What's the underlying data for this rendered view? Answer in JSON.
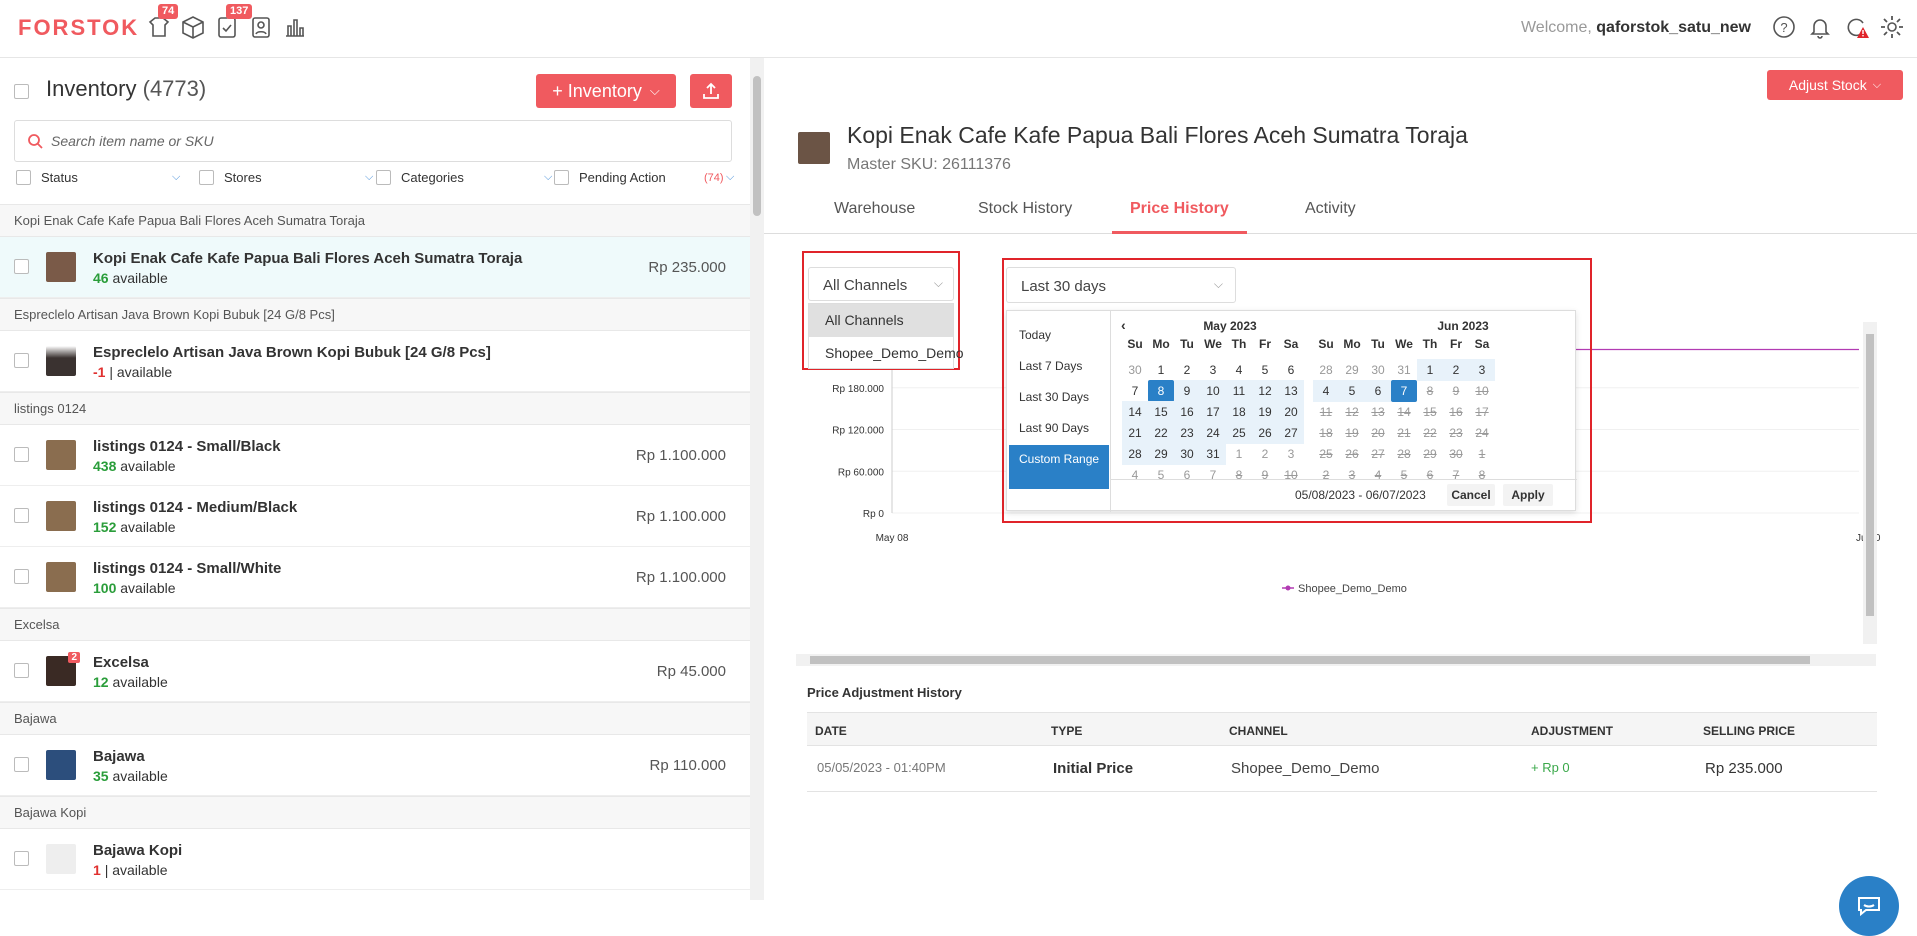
{
  "app": {
    "logo": "FORSTOK"
  },
  "nav": {
    "badges": {
      "products": "74",
      "orders": "137"
    },
    "welcome_prefix": "Welcome,",
    "username": "qaforstok_satu_new"
  },
  "inventory": {
    "title": "Inventory",
    "count": "(4773)",
    "add_button": "+ Inventory",
    "search_placeholder": "Search item name or SKU",
    "filters": {
      "status": "Status",
      "stores": "Stores",
      "categories": "Categories",
      "pending": "Pending Action",
      "pending_count": "(74)"
    },
    "groups": [
      {
        "label": "Kopi Enak Cafe Kafe Papua Bali Flores Aceh Sumatra Toraja",
        "items": [
          {
            "name": "Kopi Enak Cafe Kafe Papua Bali Flores Aceh Sumatra Toraja",
            "qty": "46",
            "suffix": "available",
            "price": "Rp 235.000"
          }
        ]
      },
      {
        "label": "Espreclelo Artisan Java Brown Kopi Bubuk [24 G/8 Pcs]",
        "items": [
          {
            "name": "Espreclelo Artisan Java Brown Kopi Bubuk [24 G/8 Pcs]",
            "qty": "-1",
            "suffix": "| available",
            "price": ""
          }
        ]
      },
      {
        "label": "listings 0124",
        "items": [
          {
            "name": "listings 0124 - Small/Black",
            "qty": "438",
            "suffix": "available",
            "price": "Rp 1.100.000"
          },
          {
            "name": "listings 0124 - Medium/Black",
            "qty": "152",
            "suffix": "available",
            "price": "Rp 1.100.000"
          },
          {
            "name": "listings 0124 - Small/White",
            "qty": "100",
            "suffix": "available",
            "price": "Rp 1.100.000"
          }
        ]
      },
      {
        "label": "Excelsa",
        "items": [
          {
            "name": "Excelsa",
            "qty": "12",
            "suffix": "available",
            "price": "Rp 45.000",
            "badge": "2"
          }
        ]
      },
      {
        "label": "Bajawa",
        "items": [
          {
            "name": "Bajawa",
            "qty": "35",
            "suffix": "available",
            "price": "Rp 110.000"
          }
        ]
      },
      {
        "label": "Bajawa Kopi",
        "items": [
          {
            "name": "Bajawa Kopi",
            "qty": "1",
            "suffix": "| available",
            "price": ""
          }
        ]
      }
    ]
  },
  "product": {
    "adjust_button": "Adjust Stock",
    "title": "Kopi Enak Cafe Kafe Papua Bali Flores Aceh Sumatra Toraja",
    "sku_label": "Master SKU: 26111376",
    "tabs": [
      "Warehouse",
      "Stock History",
      "Price History",
      "Activity"
    ],
    "active_tab": "Price History"
  },
  "channel_dropdown": {
    "selected": "All Channels",
    "options": [
      "All Channels",
      "Shopee_Demo_Demo"
    ]
  },
  "date_dropdown": {
    "selected": "Last 30 days",
    "ranges": [
      "Today",
      "Last 7 Days",
      "Last 30 Days",
      "Last 90 Days",
      "Custom Range"
    ],
    "active_range": "Custom Range",
    "weekdays": [
      "Su",
      "Mo",
      "Tu",
      "We",
      "Th",
      "Fr",
      "Sa"
    ],
    "months": [
      {
        "title": "May 2023",
        "weeks": [
          [
            "30",
            "1",
            "2",
            "3",
            "4",
            "5",
            "6"
          ],
          [
            "7",
            "8",
            "9",
            "10",
            "11",
            "12",
            "13"
          ],
          [
            "14",
            "15",
            "16",
            "17",
            "18",
            "19",
            "20"
          ],
          [
            "21",
            "22",
            "23",
            "24",
            "25",
            "26",
            "27"
          ],
          [
            "28",
            "29",
            "30",
            "31",
            "1",
            "2",
            "3"
          ],
          [
            "4",
            "5",
            "6",
            "7",
            "8",
            "9",
            "10"
          ]
        ]
      },
      {
        "title": "Jun 2023",
        "weeks": [
          [
            "28",
            "29",
            "30",
            "31",
            "1",
            "2",
            "3"
          ],
          [
            "4",
            "5",
            "6",
            "7",
            "8",
            "9",
            "10"
          ],
          [
            "11",
            "12",
            "13",
            "14",
            "15",
            "16",
            "17"
          ],
          [
            "18",
            "19",
            "20",
            "21",
            "22",
            "23",
            "24"
          ],
          [
            "25",
            "26",
            "27",
            "28",
            "29",
            "30",
            "1"
          ],
          [
            "2",
            "3",
            "4",
            "5",
            "6",
            "7",
            "8"
          ]
        ]
      }
    ],
    "range_text": "05/08/2023 - 06/07/2023",
    "cancel": "Cancel",
    "apply": "Apply"
  },
  "chart_data": {
    "type": "line",
    "yticks": [
      "Rp 0",
      "Rp 60.000",
      "Rp 120.000",
      "Rp 180.000"
    ],
    "xticks": [
      "May 08",
      "Jun 0"
    ],
    "series": [
      {
        "name": "Shopee_Demo_Demo",
        "color": "#b23bb3",
        "values": [
          235000,
          235000
        ]
      }
    ]
  },
  "price_history": {
    "title": "Price Adjustment History",
    "columns": [
      "DATE",
      "TYPE",
      "CHANNEL",
      "ADJUSTMENT",
      "SELLING PRICE"
    ],
    "rows": [
      {
        "date": "05/05/2023 - 01:40PM",
        "type": "Initial Price",
        "channel": "Shopee_Demo_Demo",
        "adjustment": "+ Rp 0",
        "selling_price": "Rp 235.000"
      }
    ]
  }
}
